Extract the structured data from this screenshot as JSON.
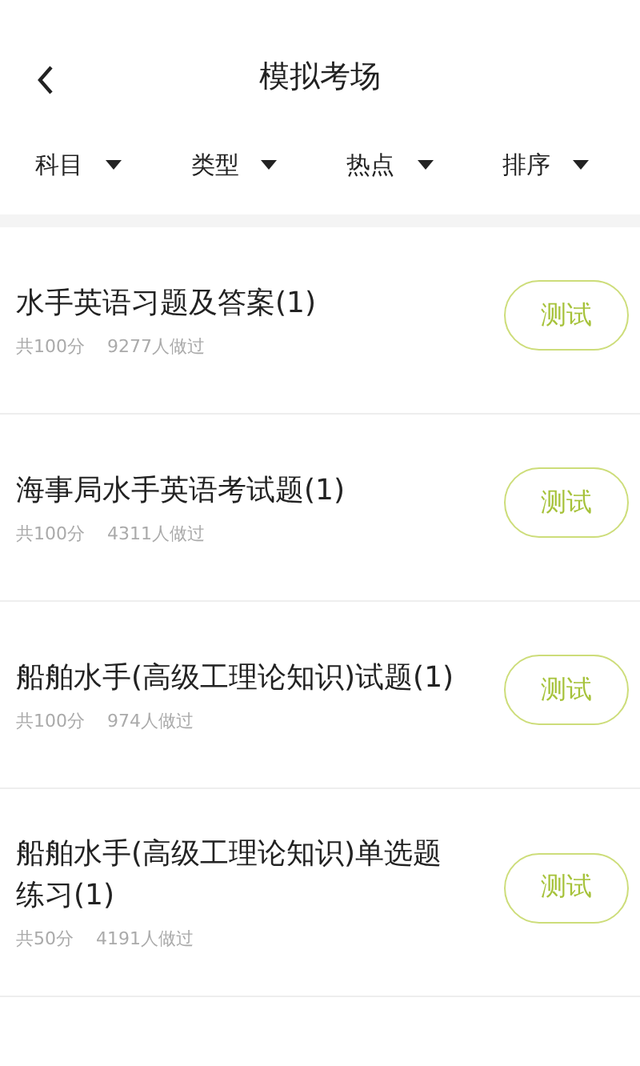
{
  "header": {
    "title": "模拟考场"
  },
  "filters": [
    {
      "label": "科目"
    },
    {
      "label": "类型"
    },
    {
      "label": "热点"
    },
    {
      "label": "排序"
    }
  ],
  "exams": [
    {
      "title": "水手英语习题及答案(1)",
      "score": "共100分",
      "takers": "9277人做过",
      "action": "测试"
    },
    {
      "title": "海事局水手英语考试题(1)",
      "score": "共100分",
      "takers": "4311人做过",
      "action": "测试"
    },
    {
      "title": "船舶水手(高级工理论知识)试题(1)",
      "score": "共100分",
      "takers": "974人做过",
      "action": "测试"
    },
    {
      "title": "船舶水手(高级工理论知识)单选题练习(1)",
      "score": "共50分",
      "takers": "4191人做过",
      "action": "测试"
    }
  ]
}
